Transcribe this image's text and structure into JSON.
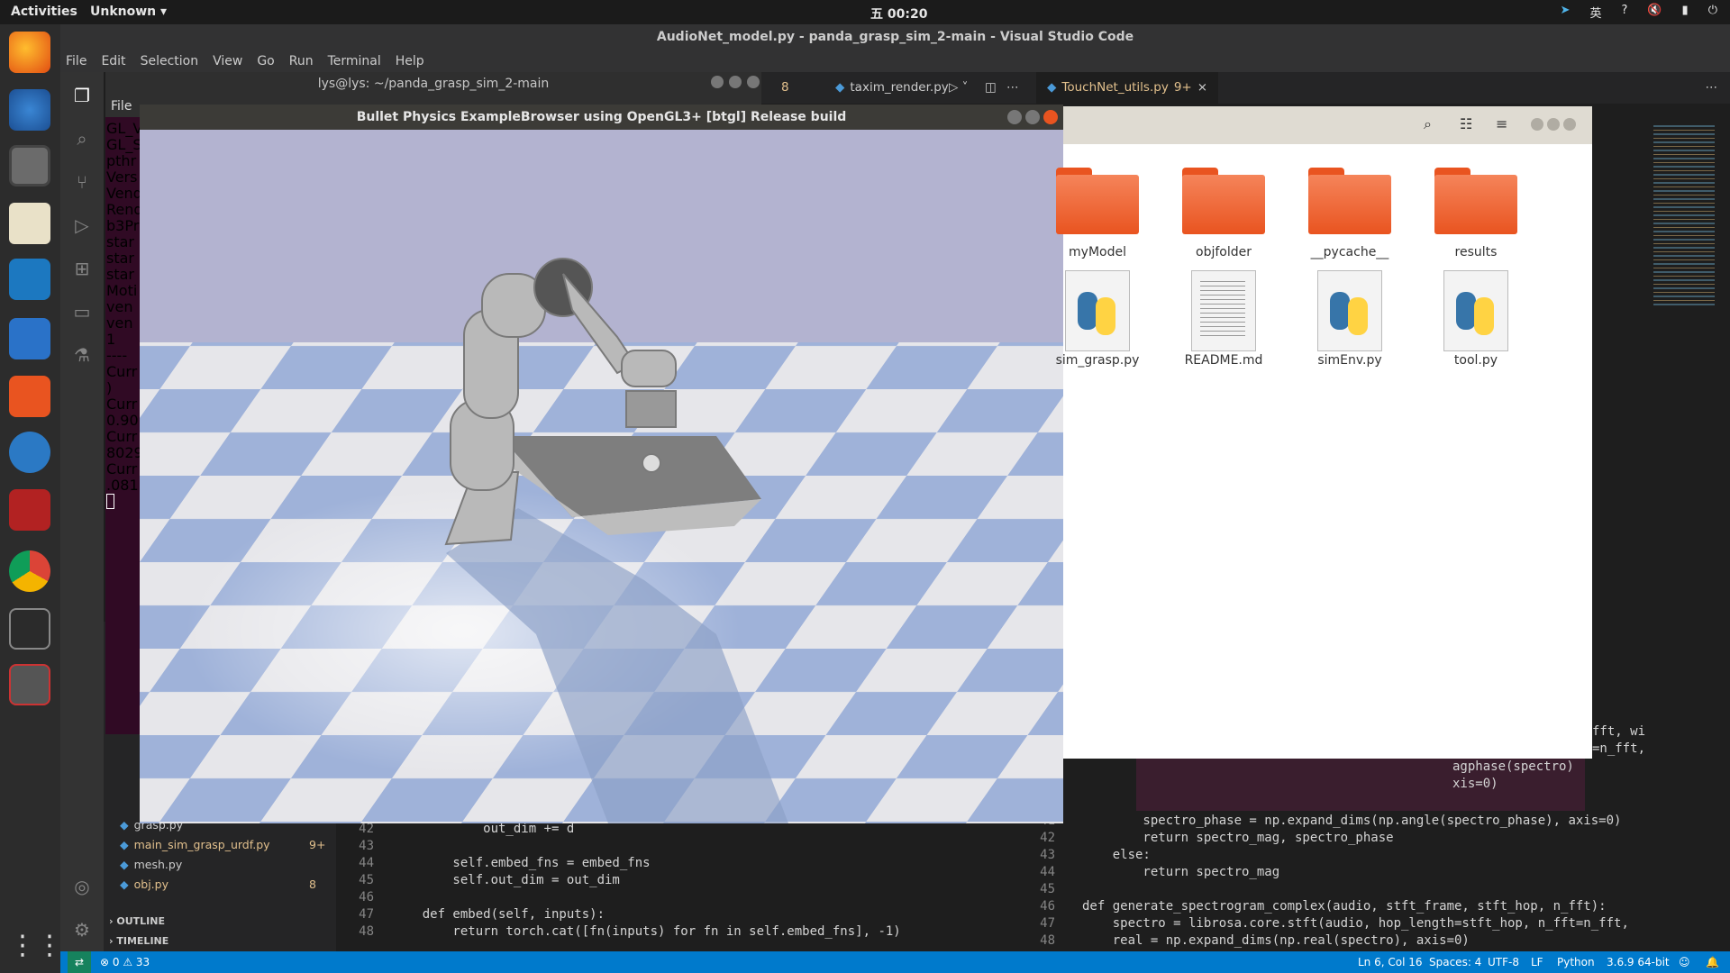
{
  "topbar": {
    "activities": "Activities",
    "app_menu": "Unknown",
    "clock": "五 00:20",
    "input_method": "英",
    "help": "?"
  },
  "vscode": {
    "title": "AudioNet_model.py - panda_grasp_sim_2-main - Visual Studio Code",
    "menu": [
      "File",
      "Edit",
      "Selection",
      "View",
      "Go",
      "Run",
      "Terminal",
      "Help"
    ],
    "tabs": [
      {
        "label": "8",
        "modified": ""
      },
      {
        "label": "taxim_render.py",
        "modified": ""
      },
      {
        "label": "TouchNet_utils.py",
        "modified": "9+"
      }
    ],
    "sidebar_files": [
      {
        "name": "grasp.py",
        "badge": ""
      },
      {
        "name": "main_sim_grasp_urdf.py",
        "badge": "9+"
      },
      {
        "name": "mesh.py",
        "badge": ""
      },
      {
        "name": "obj.py",
        "badge": "8"
      }
    ],
    "outline": "OUTLINE",
    "timeline": "TIMELINE",
    "editor_left": [
      {
        "n": "42",
        "code": "            out_dim += d"
      },
      {
        "n": "43",
        "code": ""
      },
      {
        "n": "44",
        "code": "        self.embed_fns = embed_fns"
      },
      {
        "n": "45",
        "code": "        self.out_dim = out_dim"
      },
      {
        "n": "46",
        "code": ""
      },
      {
        "n": "47",
        "code": "    def embed(self, inputs):"
      },
      {
        "n": "48",
        "code": "        return torch.cat([fn(inputs) for fn in self.embed_fns], -1)"
      }
    ],
    "editor_right_top": [
      "fft, wi",
      "=n_fft,",
      "agphase(spectro)",
      "xis=0)"
    ],
    "editor_right": [
      {
        "n": "41",
        "code": "        spectro_phase = np.expand_dims(np.angle(spectro_phase), axis=0)"
      },
      {
        "n": "42",
        "code": "        return spectro_mag, spectro_phase"
      },
      {
        "n": "43",
        "code": "    else:"
      },
      {
        "n": "44",
        "code": "        return spectro_mag"
      },
      {
        "n": "45",
        "code": ""
      },
      {
        "n": "46",
        "code": "def generate_spectrogram_complex(audio, stft_frame, stft_hop, n_fft):"
      },
      {
        "n": "47",
        "code": "    spectro = librosa.core.stft(audio, hop_length=stft_hop, n_fft=n_fft,"
      },
      {
        "n": "48",
        "code": "    real = np.expand_dims(np.real(spectro), axis=0)"
      }
    ],
    "status": {
      "errors": "0",
      "warnings": "33",
      "position": "Ln 6, Col 16",
      "spaces": "Spaces: 4",
      "encoding": "UTF-8",
      "eol": "LF",
      "language": "Python",
      "interpreter": "3.6.9 64-bit"
    }
  },
  "terminal": {
    "title": "lys@lys: ~/panda_grasp_sim_2-main",
    "menu": "File",
    "lines": [
      "GL_V",
      "GL_S",
      "pthr",
      "Vers",
      "Vend",
      "Rend",
      "b3Pr",
      "star",
      "star",
      "star",
      "Moti",
      "ven",
      "ven",
      "1",
      "----",
      "Curr",
      ")",
      "Curr",
      "0.90",
      "Curr",
      "8029",
      "Curr",
      ".081"
    ]
  },
  "bullet": {
    "title": "Bullet Physics ExampleBrowser using OpenGL3+ [btgl] Release build"
  },
  "files": {
    "items": [
      {
        "name": "myModel",
        "type": "folder"
      },
      {
        "name": "objfolder",
        "type": "folder"
      },
      {
        "name": "__pycache__",
        "type": "folder"
      },
      {
        "name": "results",
        "type": "folder"
      },
      {
        "name": "sim_grasp.py",
        "type": "python"
      },
      {
        "name": "README.md",
        "type": "text"
      },
      {
        "name": "simEnv.py",
        "type": "python"
      },
      {
        "name": "tool.py",
        "type": "python"
      }
    ]
  },
  "colors": {
    "accent": "#007acc",
    "folder": "#e95420",
    "terminal_bg": "#300a24"
  }
}
